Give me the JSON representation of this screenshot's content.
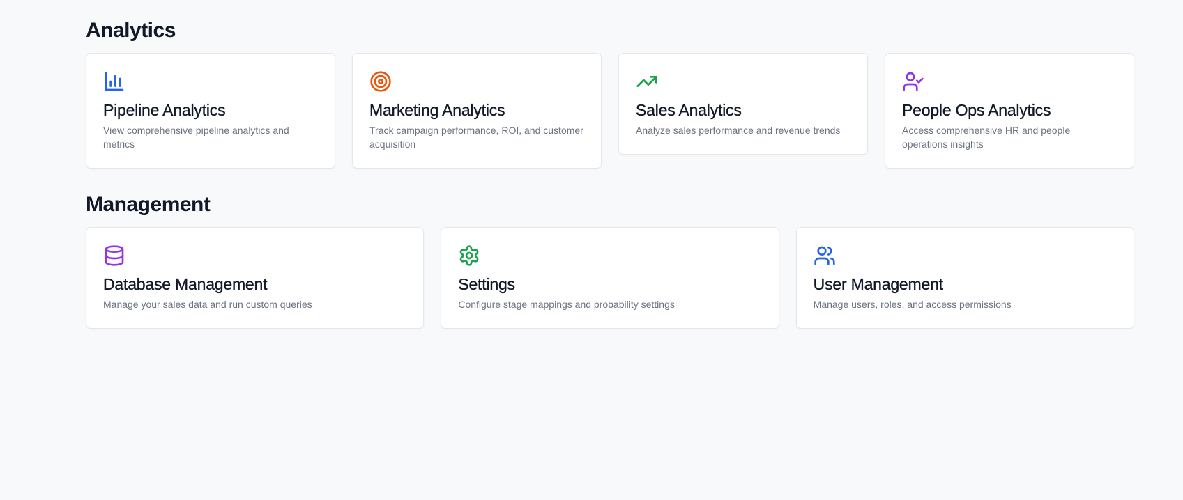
{
  "analytics": {
    "title": "Analytics",
    "cards": [
      {
        "icon": "bar-chart-icon",
        "color": "#2563eb",
        "title": "Pipeline Analytics",
        "description": "View comprehensive pipeline analytics and metrics"
      },
      {
        "icon": "target-icon",
        "color": "#ea580c",
        "title": "Marketing Analytics",
        "description": "Track campaign performance, ROI, and customer acquisition"
      },
      {
        "icon": "trending-up-icon",
        "color": "#16a34a",
        "title": "Sales Analytics",
        "description": "Analyze sales performance and revenue trends"
      },
      {
        "icon": "user-check-icon",
        "color": "#9333ea",
        "title": "People Ops Analytics",
        "description": "Access comprehensive HR and people operations insights"
      }
    ]
  },
  "management": {
    "title": "Management",
    "cards": [
      {
        "icon": "database-icon",
        "color": "#9333ea",
        "title": "Database Management",
        "description": "Manage your sales data and run custom queries"
      },
      {
        "icon": "gear-icon",
        "color": "#16a34a",
        "title": "Settings",
        "description": "Configure stage mappings and probability settings"
      },
      {
        "icon": "users-icon",
        "color": "#2563eb",
        "title": "User Management",
        "description": "Manage users, roles, and access permissions"
      }
    ]
  }
}
